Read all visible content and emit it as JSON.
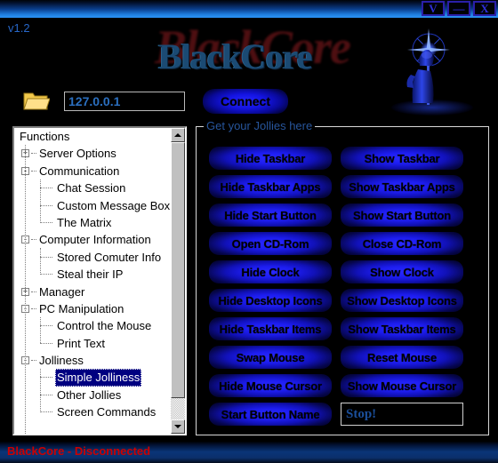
{
  "window": {
    "version_label": "v1.2",
    "logo_text": "BlackCore",
    "titlebar_buttons": [
      {
        "name": "restore-button",
        "label": "V"
      },
      {
        "name": "minimize-button",
        "label": "—"
      },
      {
        "name": "close-button",
        "label": "X"
      }
    ]
  },
  "connection": {
    "folder_icon": "folder-icon",
    "ip_value": "127.0.0.1",
    "ip_placeholder": "127.0.0.1",
    "connect_label": "Connect"
  },
  "tree": {
    "root_label": "Functions",
    "items": [
      {
        "label": "Server Options",
        "depth": 1,
        "expander": "+",
        "selected": false
      },
      {
        "label": "Communication",
        "depth": 1,
        "expander": "-",
        "selected": false
      },
      {
        "label": "Chat Session",
        "depth": 2,
        "expander": null,
        "selected": false
      },
      {
        "label": "Custom Message Box",
        "depth": 2,
        "expander": null,
        "selected": false
      },
      {
        "label": "The Matrix",
        "depth": 2,
        "expander": null,
        "selected": false
      },
      {
        "label": "Computer Information",
        "depth": 1,
        "expander": "-",
        "selected": false
      },
      {
        "label": "Stored Comuter Info",
        "depth": 2,
        "expander": null,
        "selected": false
      },
      {
        "label": "Steal their IP",
        "depth": 2,
        "expander": null,
        "selected": false
      },
      {
        "label": "Manager",
        "depth": 1,
        "expander": "+",
        "selected": false
      },
      {
        "label": "PC Manipulation",
        "depth": 1,
        "expander": "-",
        "selected": false
      },
      {
        "label": "Control the Mouse",
        "depth": 2,
        "expander": null,
        "selected": false
      },
      {
        "label": "Print Text",
        "depth": 2,
        "expander": null,
        "selected": false
      },
      {
        "label": "Jolliness",
        "depth": 1,
        "expander": "-",
        "selected": false
      },
      {
        "label": "Simple Jolliness",
        "depth": 2,
        "expander": null,
        "selected": true
      },
      {
        "label": "Other Jollies",
        "depth": 2,
        "expander": null,
        "selected": false
      },
      {
        "label": "Screen Commands",
        "depth": 2,
        "expander": null,
        "selected": false
      }
    ]
  },
  "groupbox": {
    "label": "Get your Jollies here",
    "left_buttons": [
      "Hide Taskbar",
      "Hide Taskbar Apps",
      "Hide Start Button",
      "Open CD-Rom",
      "Hide Clock",
      "Hide Desktop Icons",
      "Hide Taskbar Items",
      "Swap Mouse",
      "Hide Mouse Cursor",
      "Start Button Name"
    ],
    "right_buttons": [
      "Show Taskbar",
      "Show Taskbar Apps",
      "Show Start Button",
      "Close CD-Rom",
      "Show Clock",
      "Show Desktop Icons",
      "Show Taskbar Items",
      "Reset Mouse",
      "Show Mouse Cursor"
    ],
    "start_button_name_value": "Stop!"
  },
  "status": {
    "text": "BlackCore - Disconnected"
  },
  "colors": {
    "accent_blue": "#1d1df0",
    "status_red": "#cc0000",
    "selection_navy": "#000080",
    "label_blue": "#27559b"
  }
}
